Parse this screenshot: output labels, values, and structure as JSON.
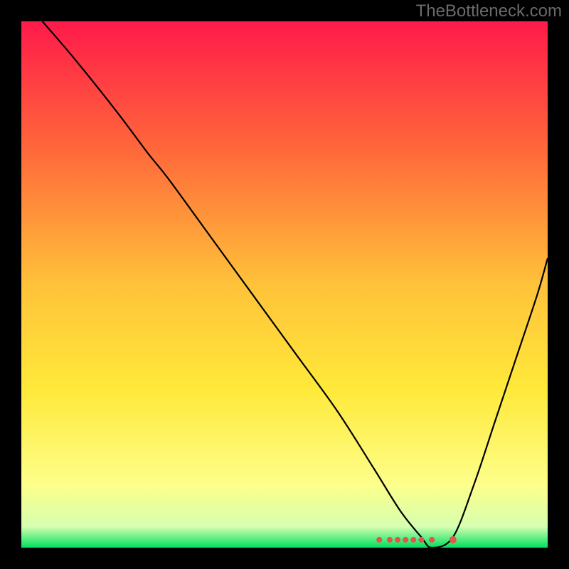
{
  "watermark": "TheBottleneck.com",
  "chart_data": {
    "type": "line",
    "title": "",
    "xlabel": "",
    "ylabel": "",
    "xlim": [
      0,
      100
    ],
    "ylim": [
      0,
      100
    ],
    "background_gradient": {
      "stops": [
        {
          "offset": 0,
          "color": "#ff1a4a"
        },
        {
          "offset": 25,
          "color": "#ff6a3a"
        },
        {
          "offset": 50,
          "color": "#ffc23a"
        },
        {
          "offset": 70,
          "color": "#ffe93a"
        },
        {
          "offset": 88,
          "color": "#fdff8a"
        },
        {
          "offset": 96,
          "color": "#d6ffb0"
        },
        {
          "offset": 100,
          "color": "#00e060"
        }
      ]
    },
    "series": [
      {
        "name": "bottleneck-curve",
        "color": "#000000",
        "x": [
          4,
          10,
          18,
          24,
          28,
          36,
          44,
          52,
          60,
          67,
          72,
          76,
          78,
          82,
          86,
          90,
          94,
          98,
          100
        ],
        "y": [
          100,
          93,
          83,
          75,
          70,
          59,
          48,
          37,
          26,
          15,
          7,
          2,
          0,
          2,
          12,
          24,
          36,
          48,
          55
        ]
      }
    ],
    "markers": {
      "name": "highlight-points",
      "color": "#e0564a",
      "points": [
        {
          "x": 68,
          "y": 1.5
        },
        {
          "x": 70,
          "y": 1.5
        },
        {
          "x": 71.5,
          "y": 1.5
        },
        {
          "x": 73,
          "y": 1.5
        },
        {
          "x": 74.5,
          "y": 1.5
        },
        {
          "x": 76,
          "y": 1.5
        },
        {
          "x": 78,
          "y": 1.5
        },
        {
          "x": 82,
          "y": 1.5
        }
      ]
    }
  }
}
